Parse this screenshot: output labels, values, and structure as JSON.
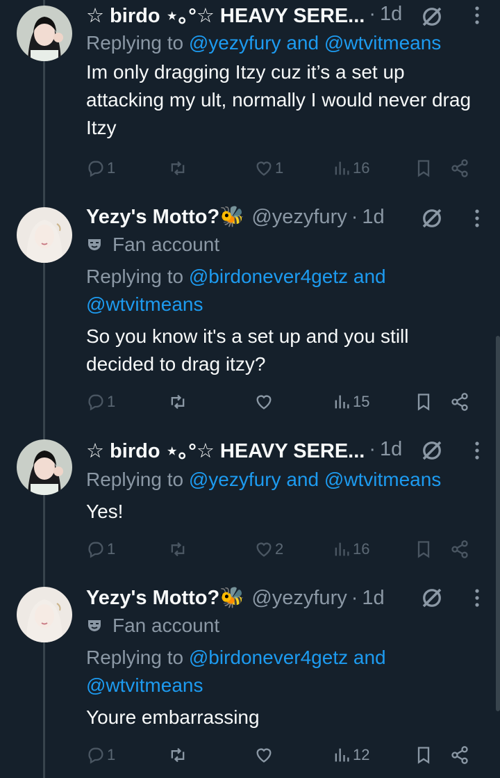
{
  "tweets": [
    {
      "name": "☆ birdo ⋆｡°☆ HEAVY SERE...",
      "handle": "",
      "time": "1d",
      "fan_label": "",
      "reply_prefix": "Replying to",
      "mentions": [
        "@yezyfury",
        "@wtvitmeans"
      ],
      "and": "and",
      "body": "Im only dragging Itzy cuz it’s a set up attacking my ult, normally I would never drag Itzy",
      "replies": "1",
      "retweets": "",
      "likes": "1",
      "views": "16"
    },
    {
      "name": "Yezy's Motto?🐝",
      "handle": "@yezyfury",
      "time": "1d",
      "fan_label": "Fan account",
      "reply_prefix": "Replying to",
      "mentions": [
        "@birdonever4getz",
        "@wtvitmeans"
      ],
      "and": "and",
      "body": "So you know it's a set up and you still decided to drag itzy?",
      "replies": "1",
      "retweets": "",
      "likes": "",
      "views": "15"
    },
    {
      "name": "☆ birdo ⋆｡°☆ HEAVY SERE...",
      "handle": "",
      "time": "1d",
      "fan_label": "",
      "reply_prefix": "Replying to",
      "mentions": [
        "@yezyfury",
        "@wtvitmeans"
      ],
      "and": "and",
      "body": "Yes!",
      "replies": "1",
      "retweets": "",
      "likes": "2",
      "views": "16"
    },
    {
      "name": "Yezy's Motto?🐝",
      "handle": "@yezyfury",
      "time": "1d",
      "fan_label": "Fan account",
      "reply_prefix": "Replying to",
      "mentions": [
        "@birdonever4getz",
        "@wtvitmeans"
      ],
      "and": "and",
      "body": "Youre embarrassing",
      "replies": "1",
      "retweets": "",
      "likes": "",
      "views": "12"
    }
  ],
  "colors": {
    "background": "#15202b",
    "text": "#f7f9f9",
    "muted": "#8b98a5",
    "link": "#1d9bf0",
    "thread_line": "#38444d"
  },
  "icons": [
    "reply-icon",
    "retweet-icon",
    "like-icon",
    "views-icon",
    "bookmark-icon",
    "share-icon",
    "grok-icon",
    "more-icon",
    "fan-mask-icon"
  ]
}
